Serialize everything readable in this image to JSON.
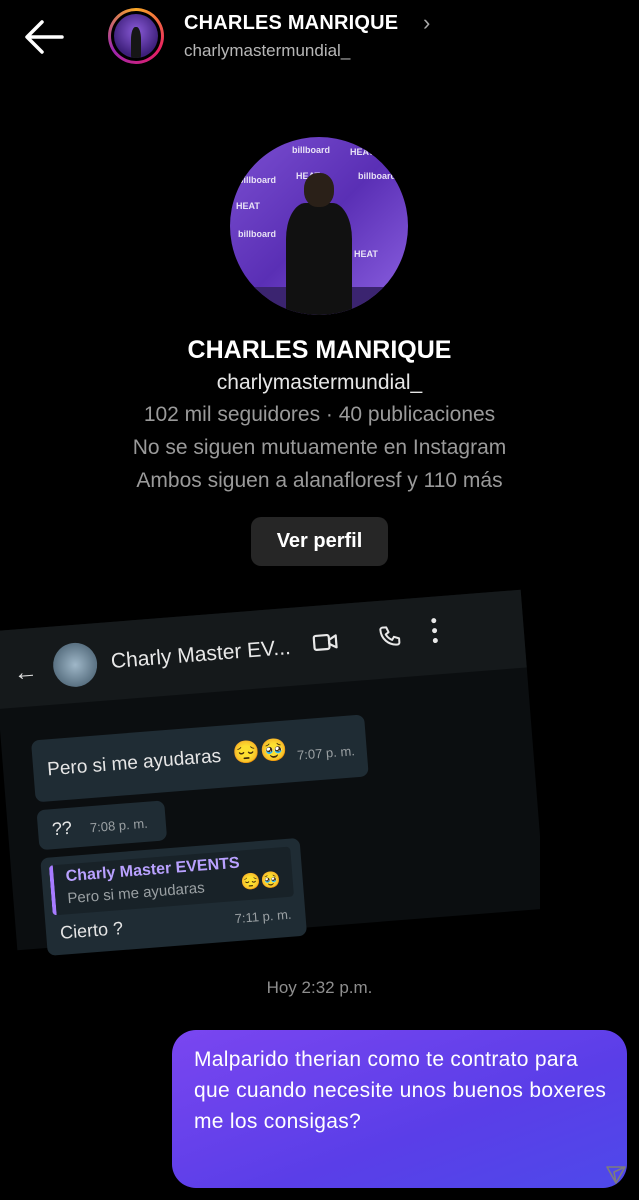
{
  "header": {
    "name": "CHARLES MANRIQUE",
    "chevron": "›",
    "username": "charlymastermundial_",
    "back_icon": "arrow-left-icon"
  },
  "profile": {
    "name": "CHARLES MANRIQUE",
    "username": "charlymastermundial_",
    "stats": "102 mil seguidores · 40 publicaciones",
    "mutual": "No se siguen mutuamente en Instagram",
    "followed_by": "Ambos siguen a alanafloresf y 110 más",
    "view_profile_label": "Ver perfil",
    "photo_words": [
      "billboard",
      "HEAT",
      "billboard",
      "HEAT",
      "billboard",
      "HEAT",
      "billboard",
      "HEAT"
    ]
  },
  "shared_image": {
    "contact": "Charly Master EV...",
    "messages": [
      {
        "text": "Pero si me ayudaras",
        "emoji": "😔🥹",
        "time": "7:07 p. m."
      },
      {
        "text": "??",
        "time": "7:08 p. m."
      },
      {
        "quote_name": "Charly Master EVENTS",
        "quote_text": "Pero si me ayudaras",
        "quote_emoji": "😔🥹",
        "text": "Cierto ?",
        "time": "7:11 p. m."
      }
    ]
  },
  "timestamp": "Hoy 2:32 p.m.",
  "outgoing_message": "Malparido therian como te contrato para que cuando necesite unos buenos boxeres me los consigas?",
  "colors": {
    "background": "#000000",
    "bubble_start": "#7a46f0",
    "bubble_end": "#4e49ea",
    "button_bg": "#262626",
    "secondary_text": "#9a9a9a"
  }
}
